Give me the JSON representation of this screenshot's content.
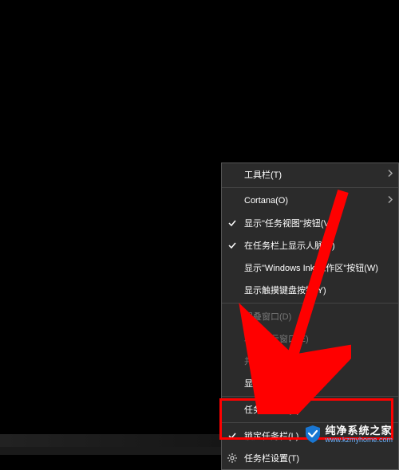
{
  "menu": {
    "toolbars": "工具栏(T)",
    "cortana": "Cortana(O)",
    "show_task_view": "显示\"任务视图\"按钮(V)",
    "show_people": "在任务栏上显示人脉(P)",
    "show_windows_ink": "显示\"Windows Ink 工作区\"按钮(W)",
    "show_touch_keyboard": "显示触摸键盘按钮(Y)",
    "cascade_windows": "层叠窗口(D)",
    "stacked_windows": "堆叠显示窗口(E)",
    "side_by_side": "并排显示窗口(I)",
    "show_desktop": "显示桌面(S)",
    "task_manager": "任务管理器(K)",
    "lock_taskbar": "锁定任务栏(L)",
    "taskbar_settings": "任务栏设置(T)"
  },
  "watermark": {
    "title": "纯净系统之家",
    "url": "www.kzmyhome.com"
  }
}
